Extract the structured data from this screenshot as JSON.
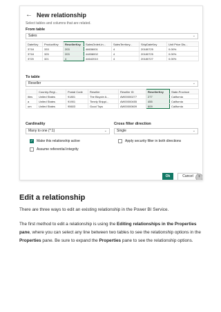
{
  "dialog": {
    "back_icon": "arrow-left-icon",
    "title": "New relationship",
    "subtitle": "Select tables and columns that are related.",
    "from_table_label": "From table",
    "from_table_value": "Sales",
    "from_grid": {
      "columns": [
        "DateKey",
        "ProductKey",
        "ResellerKey",
        "SalesOrderLin...",
        "SalesTerritory...",
        "ShipDateKey",
        "Unit Price Dis..."
      ],
      "rows": [
        [
          "3718",
          "333",
          "203",
          "46636001",
          "4",
          "20180725",
          "0.00%"
        ],
        [
          "3718",
          "325",
          "203",
          "44838002",
          "4",
          "20180725",
          "0.00%"
        ],
        [
          "3720",
          "321",
          "4",
          "44642010",
          "4",
          "20180727",
          "0.00%"
        ]
      ]
    },
    "to_table_label": "To table",
    "to_table_value": "Reseller",
    "to_grid": {
      "columns": [
        "",
        "Country-Regi...",
        "Postal Code",
        "Reseller",
        "Reseller ID",
        "ResellerKey",
        "State-Province"
      ],
      "rows": [
        [
          "ities",
          "United States",
          "91801",
          "The Bicycle A...",
          "AW00000277",
          "277",
          "California"
        ],
        [
          "a",
          "United States",
          "91901",
          "Timely Shippi...",
          "AW00000455",
          "455",
          "California"
        ],
        [
          "om",
          "United States",
          "95603",
          "Good Toys",
          "AW00000609",
          "609",
          "California"
        ]
      ]
    },
    "cardinality_label": "Cardinality",
    "cardinality_value": "Many to one (*:1)",
    "crossfilter_label": "Cross filter direction",
    "crossfilter_value": "Single",
    "make_active_label": "Make this relationship active",
    "make_active_checked": true,
    "assume_ri_label": "Assume referential integrity",
    "security_filter_label": "Apply security filter in both directions",
    "ok_label": "Ok",
    "cancel_label": "Cancel"
  },
  "article": {
    "heading": "Edit a relationship",
    "para1": "There are three ways to edit an existing relationship in the Power BI Service.",
    "para2_a": "The first method to edit a relationship is using the ",
    "para2_b": "Editing relationships in the Properties pane",
    "para2_c": ", where you can select any line between two tables to see the relationship options in the ",
    "para2_d": "Properties",
    "para2_e": " pane. Be sure to expand the ",
    "para2_f": "Properties",
    "para2_g": " pane to see the relationship options."
  }
}
